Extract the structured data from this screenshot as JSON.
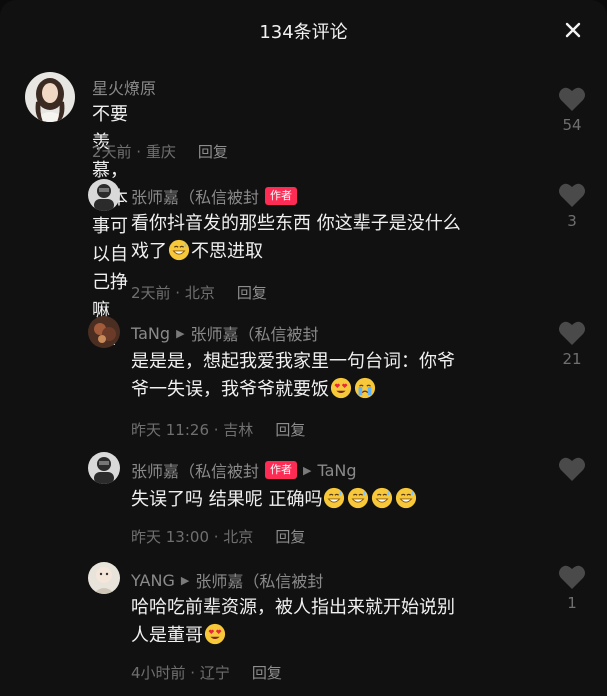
{
  "header": {
    "title": "134条评论"
  },
  "comments": [
    {
      "username": "星火燎原",
      "text": "不要羡慕，有本事可以自己挣嘛",
      "time": "2天前 · 重庆",
      "reply": "回复",
      "likes": "54"
    },
    {
      "username": "张师嘉（私信被封",
      "badge": "作者",
      "line1": "看你抖音发的那些东西 你这辈子是没什么",
      "line2a": "戏了",
      "line2b": "不思进取",
      "time": "2天前 · 北京",
      "reply": "回复",
      "likes": "3"
    },
    {
      "username": "TaNg",
      "reply_to": "张师嘉（私信被封",
      "line1": "是是是，想起我爱我家里一句台词：你爷",
      "line2": "爷一失误，我爷爷就要饭",
      "time": "昨天 11:26 · 吉林",
      "reply": "回复",
      "likes": "21"
    },
    {
      "username": "张师嘉（私信被封",
      "badge": "作者",
      "reply_to": "TaNg",
      "text": "失误了吗 结果呢 正确吗",
      "time": "昨天 13:00 · 北京",
      "reply": "回复",
      "likes": ""
    },
    {
      "username": "YANG",
      "reply_to": "张师嘉（私信被封",
      "line1": "哈哈吃前辈资源，被人指出来就开始说别",
      "line2": "人是董哥",
      "time": "4小时前 · 辽宁",
      "reply": "回复",
      "likes": "1"
    }
  ],
  "icons": {
    "close": "close-icon",
    "like": "heart-icon",
    "arrow": "triangle-right-icon"
  },
  "colors": {
    "background": "#111111",
    "author_badge": "#fe2c55",
    "muted": "#6f6f6f"
  }
}
